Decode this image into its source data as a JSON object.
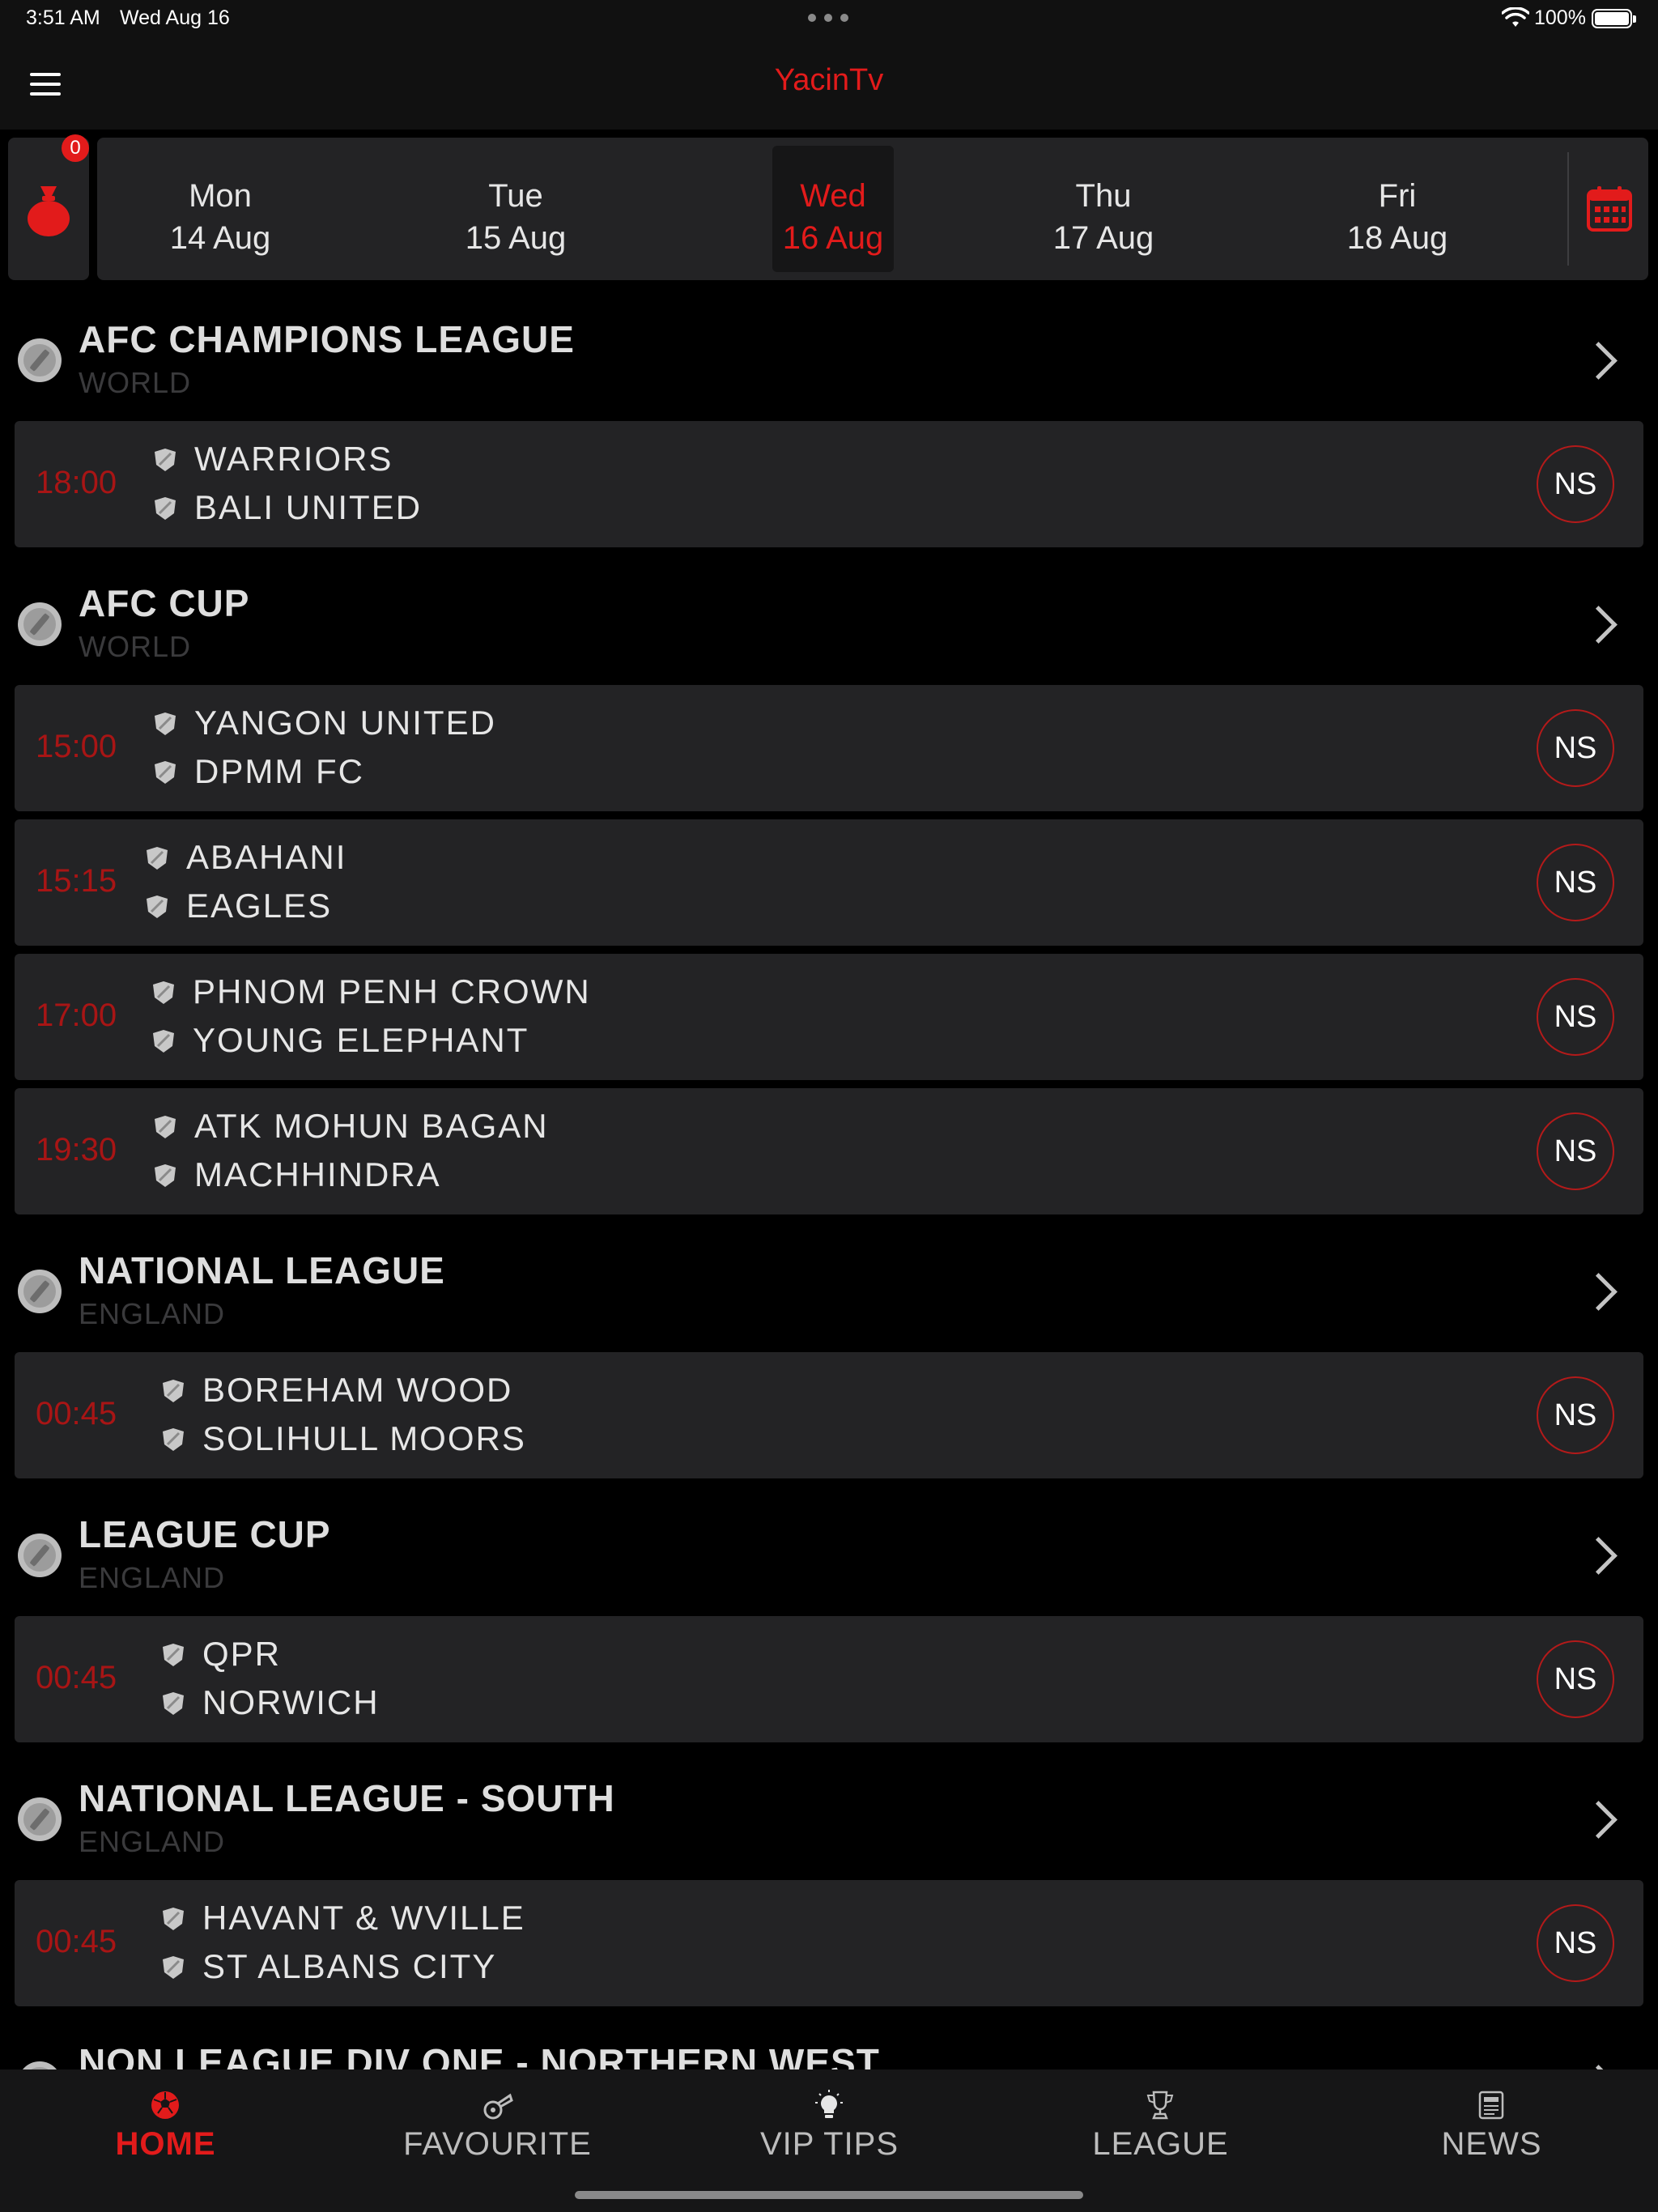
{
  "status_bar": {
    "time": "3:51 AM",
    "date": "Wed Aug 16",
    "battery": "100%"
  },
  "header": {
    "title": "YacinTv"
  },
  "basket": {
    "badge": "0"
  },
  "dates": [
    {
      "day": "Mon",
      "date": "14 Aug",
      "selected": false
    },
    {
      "day": "Tue",
      "date": "15 Aug",
      "selected": false
    },
    {
      "day": "Wed",
      "date": "16 Aug",
      "selected": true
    },
    {
      "day": "Thu",
      "date": "17 Aug",
      "selected": false
    },
    {
      "day": "Fri",
      "date": "18 Aug",
      "selected": false
    }
  ],
  "leagues": [
    {
      "name": "AFC CHAMPIONS LEAGUE",
      "country": "WORLD",
      "matches": [
        {
          "time": "18:00",
          "home": "WARRIORS",
          "away": "BALI UNITED",
          "status": "NS"
        }
      ]
    },
    {
      "name": "AFC CUP",
      "country": "WORLD",
      "matches": [
        {
          "time": "15:00",
          "home": "YANGON UNITED",
          "away": "DPMM FC",
          "status": "NS"
        },
        {
          "time": "15:15",
          "home": "ABAHANI",
          "away": "EAGLES",
          "status": "NS"
        },
        {
          "time": "17:00",
          "home": "PHNOM PENH CROWN",
          "away": "YOUNG ELEPHANT",
          "status": "NS"
        },
        {
          "time": "19:30",
          "home": "ATK MOHUN BAGAN",
          "away": "MACHHINDRA",
          "status": "NS"
        }
      ]
    },
    {
      "name": "NATIONAL LEAGUE",
      "country": "ENGLAND",
      "matches": [
        {
          "time": "00:45",
          "home": "BOREHAM WOOD",
          "away": "SOLIHULL MOORS",
          "status": "NS"
        }
      ]
    },
    {
      "name": "LEAGUE CUP",
      "country": "ENGLAND",
      "matches": [
        {
          "time": "00:45",
          "home": "QPR",
          "away": "NORWICH",
          "status": "NS"
        }
      ]
    },
    {
      "name": "NATIONAL LEAGUE - SOUTH",
      "country": "ENGLAND",
      "matches": [
        {
          "time": "00:45",
          "home": "HAVANT & WVILLE",
          "away": "ST ALBANS CITY",
          "status": "NS"
        }
      ]
    },
    {
      "name": "NON LEAGUE DIV ONE - NORTHERN WEST",
      "country": "",
      "matches": []
    }
  ],
  "tabs": [
    {
      "label": "HOME",
      "icon": "soccer-ball-icon",
      "active": true
    },
    {
      "label": "FAVOURITE",
      "icon": "whistle-icon",
      "active": false
    },
    {
      "label": "VIP TIPS",
      "icon": "lightbulb-icon",
      "active": false
    },
    {
      "label": "LEAGUE",
      "icon": "trophy-icon",
      "active": false
    },
    {
      "label": "NEWS",
      "icon": "newspaper-icon",
      "active": false
    }
  ],
  "colors": {
    "accent": "#e21b1b",
    "time": "#a81515",
    "card": "#232325",
    "background": "#000000"
  }
}
